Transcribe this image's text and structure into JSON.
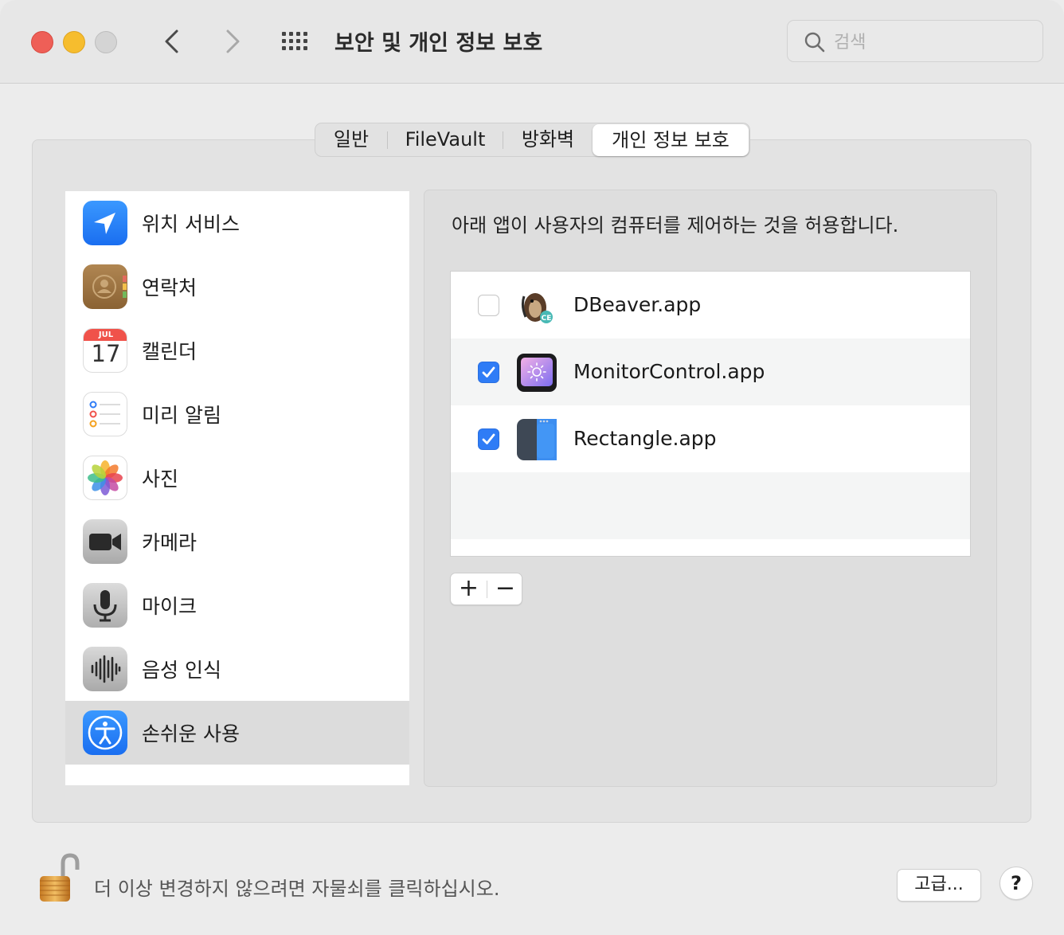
{
  "window": {
    "title": "보안 및 개인 정보 보호",
    "search_placeholder": "검색"
  },
  "tabs": [
    {
      "label": "일반"
    },
    {
      "label": "FileVault"
    },
    {
      "label": "방화벽"
    },
    {
      "label": "개인 정보 보호",
      "selected": true
    }
  ],
  "sidebar": {
    "items": [
      {
        "label": "위치 서비스",
        "icon": "location-arrow-icon"
      },
      {
        "label": "연락처",
        "icon": "contacts-icon"
      },
      {
        "label": "캘린더",
        "icon": "calendar-icon",
        "cal_month": "JUL",
        "cal_day": "17"
      },
      {
        "label": "미리 알림",
        "icon": "reminders-icon"
      },
      {
        "label": "사진",
        "icon": "photos-icon"
      },
      {
        "label": "카메라",
        "icon": "camera-icon"
      },
      {
        "label": "마이크",
        "icon": "microphone-icon"
      },
      {
        "label": "음성 인식",
        "icon": "speech-recognition-icon"
      },
      {
        "label": "손쉬운 사용",
        "icon": "accessibility-icon",
        "selected": true
      }
    ]
  },
  "detail": {
    "description": "아래 앱이 사용자의 컴퓨터를 제어하는 것을 허용합니다.",
    "apps": [
      {
        "name": "DBeaver.app",
        "checked": false,
        "icon": "dbeaver-icon"
      },
      {
        "name": "MonitorControl.app",
        "checked": true,
        "icon": "monitorcontrol-icon"
      },
      {
        "name": "Rectangle.app",
        "checked": true,
        "icon": "rectangle-icon"
      }
    ],
    "add_label": "+",
    "remove_label": "−"
  },
  "footer": {
    "lock_text": "더 이상 변경하지 않으려면 자물쇠를 클릭하십시오.",
    "advanced_label": "고급...",
    "help_label": "?"
  },
  "colors": {
    "checkbox_accent": "#2f7cf6",
    "close": "#ee5f57",
    "minimize": "#f6bd2e"
  }
}
